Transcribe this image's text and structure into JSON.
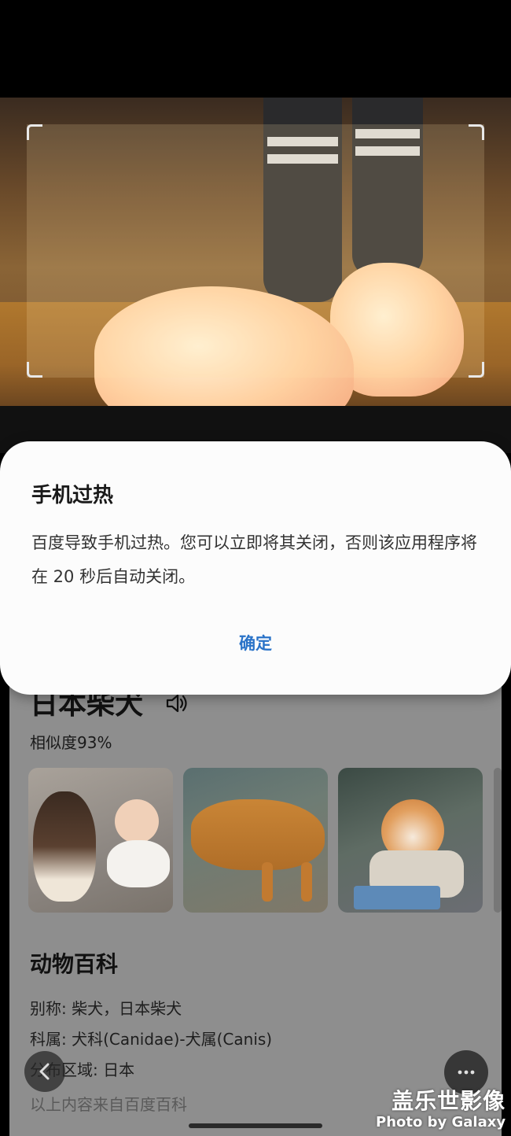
{
  "dialog": {
    "title": "手机过热",
    "message": "百度导致手机过热。您可以立即将其关闭，否则该应用程序将在 20 秒后自动关闭。",
    "ok_label": "确定",
    "accent_color": "#2a73c8"
  },
  "result": {
    "name": "日本柴犬",
    "similarity": "相似度93%",
    "thumbnails": [
      "shiba-with-baby",
      "shiba-standing",
      "shiba-in-shop"
    ]
  },
  "encyclopedia": {
    "title": "动物百科",
    "alias": "别称: 柴犬，日本柴犬",
    "family": "科属: 犬科(Canidae)-犬属(Canis)",
    "region": "分布区域: 日本",
    "source": "以上内容来自百度百科"
  },
  "watermark": {
    "cn": "盖乐世影像",
    "en": "Photo by Galaxy"
  },
  "icons": {
    "speaker": "speaker-icon",
    "back": "chevron-left-icon",
    "more": "more-dots-icon"
  }
}
